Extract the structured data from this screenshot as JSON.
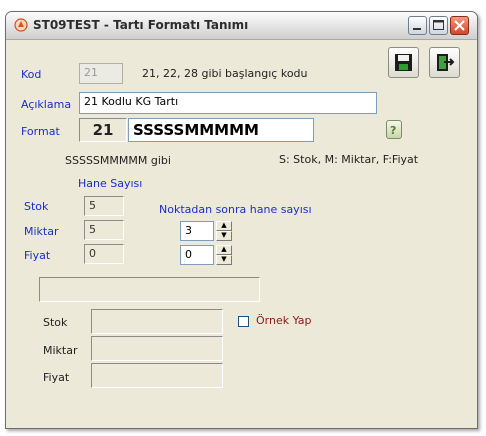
{
  "window": {
    "title": "ST09TEST - Tartı Formatı Tanımı",
    "icons": {
      "app": "app-logo-icon",
      "minimize": "minimize-icon",
      "maximize": "maximize-icon",
      "close": "close-icon",
      "save": "save-disk-icon",
      "exit": "exit-door-icon",
      "help": "question-icon"
    }
  },
  "form": {
    "kod": {
      "label": "Kod",
      "value": "21",
      "hint": "21, 22, 28 gibi başlangıç kodu"
    },
    "aciklama": {
      "label": "Açıklama",
      "value": "21 Kodlu KG Tartı"
    },
    "format": {
      "label": "Format",
      "prefix": "21",
      "value": "SSSSSMMMMM"
    },
    "example_text": "SSSSSMMMMM gibi",
    "legend": "S: Stok, M: Miktar, F:Fiyat",
    "hane_sayisi_label": "Hane Sayısı",
    "noktadan_label": "Noktadan sonra hane sayısı",
    "stok": {
      "label": "Stok",
      "hane": "5"
    },
    "miktar": {
      "label": "Miktar",
      "hane": "5",
      "decimals": "3"
    },
    "fiyat": {
      "label": "Fiyat",
      "hane": "0",
      "decimals": "0"
    }
  },
  "sample": {
    "input_value": "",
    "stok_label": "Stok",
    "miktar_label": "Miktar",
    "fiyat_label": "Fiyat",
    "ornek_label": "Örnek Yap",
    "ornek_checked": false
  },
  "colors": {
    "label_blue": "#1a2ec8",
    "checkbox_label": "#8b1a1a",
    "window_bg": "#ece9d8"
  }
}
